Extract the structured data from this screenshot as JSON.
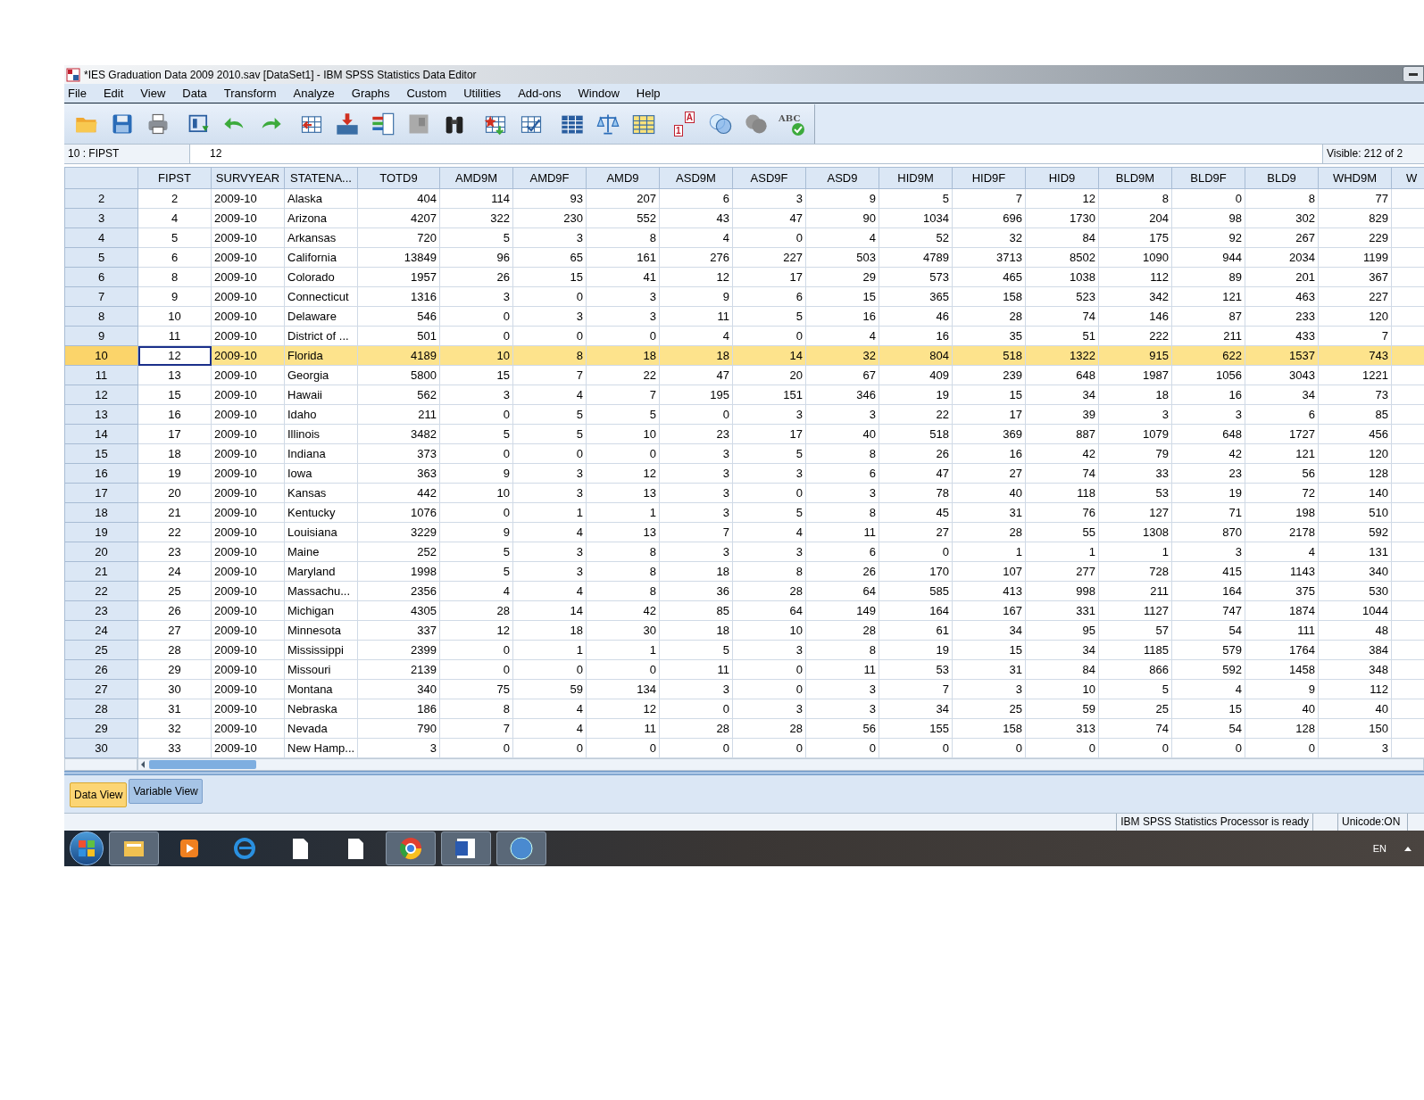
{
  "window": {
    "title": "*IES Graduation Data 2009 2010.sav [DataSet1] - IBM SPSS Statistics Data Editor"
  },
  "menu": [
    "File",
    "Edit",
    "View",
    "Data",
    "Transform",
    "Analyze",
    "Graphs",
    "Custom",
    "Utilities",
    "Add-ons",
    "Window",
    "Help"
  ],
  "toolbar_texts": {
    "value_labels_a": "A",
    "value_labels_1": "1",
    "spellcheck": "ABC"
  },
  "cell_editor": {
    "cell": "10 : FIPST",
    "value": "12",
    "visible": "Visible: 212 of 2"
  },
  "columns": [
    {
      "label": "FIPST",
      "kind": "centered",
      "focused": true
    },
    {
      "label": "SURVYEAR",
      "kind": "string",
      "focused": false
    },
    {
      "label": "STATENA...",
      "kind": "string",
      "focused": false
    },
    {
      "label": "TOTD9",
      "kind": "numeric",
      "focused": false
    },
    {
      "label": "AMD9M",
      "kind": "numeric",
      "focused": false
    },
    {
      "label": "AMD9F",
      "kind": "numeric",
      "focused": false
    },
    {
      "label": "AMD9",
      "kind": "numeric",
      "focused": false
    },
    {
      "label": "ASD9M",
      "kind": "numeric",
      "focused": false
    },
    {
      "label": "ASD9F",
      "kind": "numeric",
      "focused": false
    },
    {
      "label": "ASD9",
      "kind": "numeric",
      "focused": false
    },
    {
      "label": "HID9M",
      "kind": "numeric",
      "focused": false
    },
    {
      "label": "HID9F",
      "kind": "numeric",
      "focused": false
    },
    {
      "label": "HID9",
      "kind": "numeric",
      "focused": false
    },
    {
      "label": "BLD9M",
      "kind": "numeric",
      "focused": false
    },
    {
      "label": "BLD9F",
      "kind": "numeric",
      "focused": false
    },
    {
      "label": "BLD9",
      "kind": "numeric",
      "focused": false
    },
    {
      "label": "WHD9M",
      "kind": "numeric",
      "focused": false
    },
    {
      "label": "W",
      "kind": "numeric",
      "focused": false
    }
  ],
  "rows": [
    {
      "header": "2",
      "selected": false,
      "cells": [
        "2",
        "2009-10",
        "Alaska",
        "404",
        "114",
        "93",
        "207",
        "6",
        "3",
        "9",
        "5",
        "7",
        "12",
        "8",
        "0",
        "8",
        "77"
      ]
    },
    {
      "header": "3",
      "selected": false,
      "cells": [
        "4",
        "2009-10",
        "Arizona",
        "4207",
        "322",
        "230",
        "552",
        "43",
        "47",
        "90",
        "1034",
        "696",
        "1730",
        "204",
        "98",
        "302",
        "829"
      ]
    },
    {
      "header": "4",
      "selected": false,
      "cells": [
        "5",
        "2009-10",
        "Arkansas",
        "720",
        "5",
        "3",
        "8",
        "4",
        "0",
        "4",
        "52",
        "32",
        "84",
        "175",
        "92",
        "267",
        "229"
      ]
    },
    {
      "header": "5",
      "selected": false,
      "cells": [
        "6",
        "2009-10",
        "California",
        "13849",
        "96",
        "65",
        "161",
        "276",
        "227",
        "503",
        "4789",
        "3713",
        "8502",
        "1090",
        "944",
        "2034",
        "1199"
      ]
    },
    {
      "header": "6",
      "selected": false,
      "cells": [
        "8",
        "2009-10",
        "Colorado",
        "1957",
        "26",
        "15",
        "41",
        "12",
        "17",
        "29",
        "573",
        "465",
        "1038",
        "112",
        "89",
        "201",
        "367"
      ]
    },
    {
      "header": "7",
      "selected": false,
      "cells": [
        "9",
        "2009-10",
        "Connecticut",
        "1316",
        "3",
        "0",
        "3",
        "9",
        "6",
        "15",
        "365",
        "158",
        "523",
        "342",
        "121",
        "463",
        "227"
      ]
    },
    {
      "header": "8",
      "selected": false,
      "cells": [
        "10",
        "2009-10",
        "Delaware",
        "546",
        "0",
        "3",
        "3",
        "11",
        "5",
        "16",
        "46",
        "28",
        "74",
        "146",
        "87",
        "233",
        "120"
      ]
    },
    {
      "header": "9",
      "selected": false,
      "cells": [
        "11",
        "2009-10",
        "District of ...",
        "501",
        "0",
        "0",
        "0",
        "4",
        "0",
        "4",
        "16",
        "35",
        "51",
        "222",
        "211",
        "433",
        "7"
      ]
    },
    {
      "header": "10",
      "selected": true,
      "cells": [
        "12",
        "2009-10",
        "Florida",
        "4189",
        "10",
        "8",
        "18",
        "18",
        "14",
        "32",
        "804",
        "518",
        "1322",
        "915",
        "622",
        "1537",
        "743"
      ]
    },
    {
      "header": "11",
      "selected": false,
      "cells": [
        "13",
        "2009-10",
        "Georgia",
        "5800",
        "15",
        "7",
        "22",
        "47",
        "20",
        "67",
        "409",
        "239",
        "648",
        "1987",
        "1056",
        "3043",
        "1221"
      ]
    },
    {
      "header": "12",
      "selected": false,
      "cells": [
        "15",
        "2009-10",
        "Hawaii",
        "562",
        "3",
        "4",
        "7",
        "195",
        "151",
        "346",
        "19",
        "15",
        "34",
        "18",
        "16",
        "34",
        "73"
      ]
    },
    {
      "header": "13",
      "selected": false,
      "cells": [
        "16",
        "2009-10",
        "Idaho",
        "211",
        "0",
        "5",
        "5",
        "0",
        "3",
        "3",
        "22",
        "17",
        "39",
        "3",
        "3",
        "6",
        "85"
      ]
    },
    {
      "header": "14",
      "selected": false,
      "cells": [
        "17",
        "2009-10",
        "Illinois",
        "3482",
        "5",
        "5",
        "10",
        "23",
        "17",
        "40",
        "518",
        "369",
        "887",
        "1079",
        "648",
        "1727",
        "456"
      ]
    },
    {
      "header": "15",
      "selected": false,
      "cells": [
        "18",
        "2009-10",
        "Indiana",
        "373",
        "0",
        "0",
        "0",
        "3",
        "5",
        "8",
        "26",
        "16",
        "42",
        "79",
        "42",
        "121",
        "120"
      ]
    },
    {
      "header": "16",
      "selected": false,
      "cells": [
        "19",
        "2009-10",
        "Iowa",
        "363",
        "9",
        "3",
        "12",
        "3",
        "3",
        "6",
        "47",
        "27",
        "74",
        "33",
        "23",
        "56",
        "128"
      ]
    },
    {
      "header": "17",
      "selected": false,
      "cells": [
        "20",
        "2009-10",
        "Kansas",
        "442",
        "10",
        "3",
        "13",
        "3",
        "0",
        "3",
        "78",
        "40",
        "118",
        "53",
        "19",
        "72",
        "140"
      ]
    },
    {
      "header": "18",
      "selected": false,
      "cells": [
        "21",
        "2009-10",
        "Kentucky",
        "1076",
        "0",
        "1",
        "1",
        "3",
        "5",
        "8",
        "45",
        "31",
        "76",
        "127",
        "71",
        "198",
        "510"
      ]
    },
    {
      "header": "19",
      "selected": false,
      "cells": [
        "22",
        "2009-10",
        "Louisiana",
        "3229",
        "9",
        "4",
        "13",
        "7",
        "4",
        "11",
        "27",
        "28",
        "55",
        "1308",
        "870",
        "2178",
        "592"
      ]
    },
    {
      "header": "20",
      "selected": false,
      "cells": [
        "23",
        "2009-10",
        "Maine",
        "252",
        "5",
        "3",
        "8",
        "3",
        "3",
        "6",
        "0",
        "1",
        "1",
        "1",
        "3",
        "4",
        "131"
      ]
    },
    {
      "header": "21",
      "selected": false,
      "cells": [
        "24",
        "2009-10",
        "Maryland",
        "1998",
        "5",
        "3",
        "8",
        "18",
        "8",
        "26",
        "170",
        "107",
        "277",
        "728",
        "415",
        "1143",
        "340"
      ]
    },
    {
      "header": "22",
      "selected": false,
      "cells": [
        "25",
        "2009-10",
        "Massachu...",
        "2356",
        "4",
        "4",
        "8",
        "36",
        "28",
        "64",
        "585",
        "413",
        "998",
        "211",
        "164",
        "375",
        "530"
      ]
    },
    {
      "header": "23",
      "selected": false,
      "cells": [
        "26",
        "2009-10",
        "Michigan",
        "4305",
        "28",
        "14",
        "42",
        "85",
        "64",
        "149",
        "164",
        "167",
        "331",
        "1127",
        "747",
        "1874",
        "1044"
      ]
    },
    {
      "header": "24",
      "selected": false,
      "cells": [
        "27",
        "2009-10",
        "Minnesota",
        "337",
        "12",
        "18",
        "30",
        "18",
        "10",
        "28",
        "61",
        "34",
        "95",
        "57",
        "54",
        "111",
        "48"
      ]
    },
    {
      "header": "25",
      "selected": false,
      "cells": [
        "28",
        "2009-10",
        "Mississippi",
        "2399",
        "0",
        "1",
        "1",
        "5",
        "3",
        "8",
        "19",
        "15",
        "34",
        "1185",
        "579",
        "1764",
        "384"
      ]
    },
    {
      "header": "26",
      "selected": false,
      "cells": [
        "29",
        "2009-10",
        "Missouri",
        "2139",
        "0",
        "0",
        "0",
        "11",
        "0",
        "11",
        "53",
        "31",
        "84",
        "866",
        "592",
        "1458",
        "348"
      ]
    },
    {
      "header": "27",
      "selected": false,
      "cells": [
        "30",
        "2009-10",
        "Montana",
        "340",
        "75",
        "59",
        "134",
        "3",
        "0",
        "3",
        "7",
        "3",
        "10",
        "5",
        "4",
        "9",
        "112"
      ]
    },
    {
      "header": "28",
      "selected": false,
      "cells": [
        "31",
        "2009-10",
        "Nebraska",
        "186",
        "8",
        "4",
        "12",
        "0",
        "3",
        "3",
        "34",
        "25",
        "59",
        "25",
        "15",
        "40",
        "40"
      ]
    },
    {
      "header": "29",
      "selected": false,
      "cells": [
        "32",
        "2009-10",
        "Nevada",
        "790",
        "7",
        "4",
        "11",
        "28",
        "28",
        "56",
        "155",
        "158",
        "313",
        "74",
        "54",
        "128",
        "150"
      ]
    },
    {
      "header": "30",
      "selected": false,
      "cells": [
        "33",
        "2009-10",
        "New Hamp...",
        "3",
        "0",
        "0",
        "0",
        "0",
        "0",
        "0",
        "0",
        "0",
        "0",
        "0",
        "0",
        "0",
        "3"
      ]
    }
  ],
  "view_tabs": [
    {
      "label": "Data View",
      "selected": true
    },
    {
      "label": "Variable View",
      "selected": false
    }
  ],
  "status_bar": {
    "message": "IBM SPSS Statistics Processor is ready",
    "encoding": "Unicode:ON"
  },
  "taskbar": {
    "language": "EN"
  }
}
